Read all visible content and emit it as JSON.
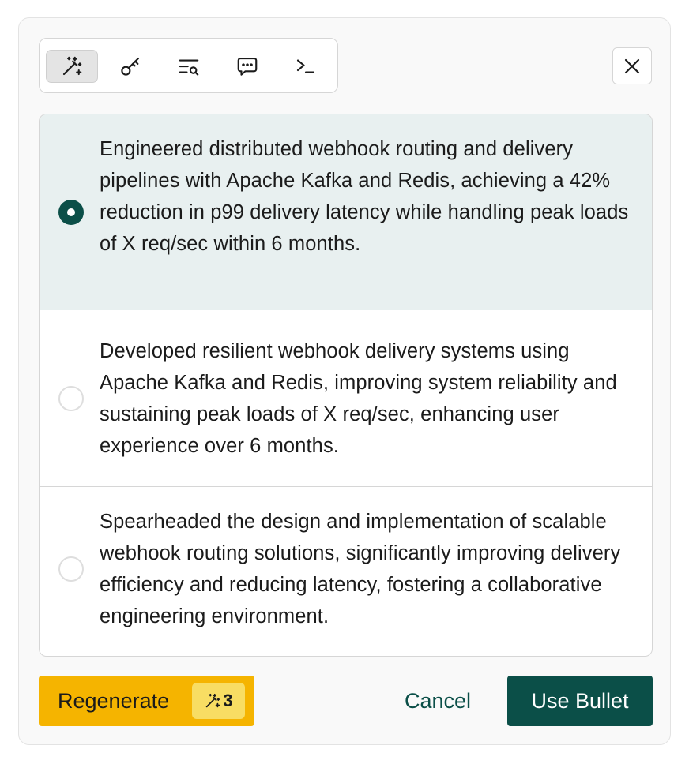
{
  "toolbar": {
    "tools": [
      {
        "icon": "magic-wand-icon",
        "active": true
      },
      {
        "icon": "key-icon",
        "active": false
      },
      {
        "icon": "list-search-icon",
        "active": false
      },
      {
        "icon": "chat-icon",
        "active": false
      },
      {
        "icon": "terminal-icon",
        "active": false
      }
    ]
  },
  "close": {
    "icon": "close-icon"
  },
  "options": [
    {
      "text": "Engineered distributed webhook routing and delivery pipelines with Apache Kafka and Redis, achieving a 42% reduction in p99 delivery latency while handling peak loads of X req/sec within 6 months.",
      "selected": true
    },
    {
      "text": "Developed resilient webhook delivery systems using Apache Kafka and Redis, improving system reliability and sustaining peak loads of X req/sec, enhancing user experience over 6 months.",
      "selected": false
    },
    {
      "text": "Spearheaded the design and implementation of scalable webhook routing solutions, significantly improving delivery efficiency and reducing latency, fostering a collaborative engineering environment.",
      "selected": false
    }
  ],
  "footer": {
    "regenerate_label": "Regenerate",
    "regenerate_credits": "3",
    "cancel_label": "Cancel",
    "use_label": "Use Bullet"
  },
  "colors": {
    "accent": "#0b4f48",
    "regenerate": "#f5b400",
    "badge": "#f8dd63",
    "selected_bg": "#e8f0f0"
  }
}
